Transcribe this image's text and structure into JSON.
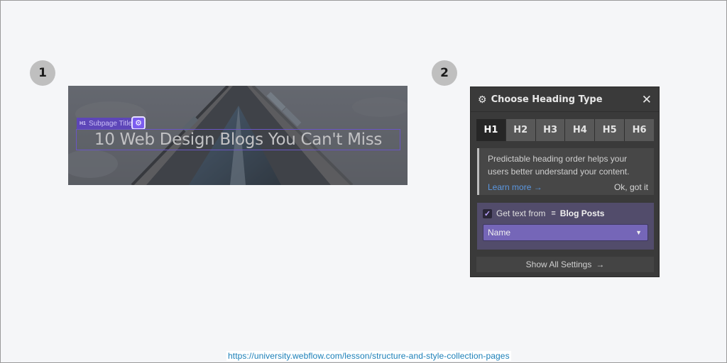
{
  "steps": [
    {
      "number": "1"
    },
    {
      "number": "2"
    }
  ],
  "canvas": {
    "element_tag": "H1",
    "element_label": "Subpage Title",
    "settings_icon": "gear-icon",
    "heading_text": "10 Web Design Blogs You Can't Miss"
  },
  "popup": {
    "title": "Choose Heading Type",
    "header_icon": "gear-icon",
    "close_icon": "close-icon",
    "tabs": [
      {
        "label": "H1",
        "active": true
      },
      {
        "label": "H2",
        "active": false
      },
      {
        "label": "H3",
        "active": false
      },
      {
        "label": "H4",
        "active": false
      },
      {
        "label": "H5",
        "active": false
      },
      {
        "label": "H6",
        "active": false
      }
    ],
    "notice": {
      "text": "Predictable heading order helps your users better understand your content.",
      "learn_more": "Learn more →",
      "dismiss": "Ok, got it"
    },
    "collection_binding": {
      "checked": true,
      "label": "Get text from",
      "collection_icon": "database-icon",
      "collection_name": "Blog Posts",
      "field_value": "Name"
    },
    "show_all_settings": "Show All Settings",
    "show_all_arrow": "→"
  },
  "colors": {
    "accent_purple": "#7b5cf0",
    "link_blue": "#5b97e0",
    "panel_bg": "#3a3a3a"
  },
  "footer": {
    "source_url": "https://university.webflow.com/lesson/structure-and-style-collection-pages"
  }
}
